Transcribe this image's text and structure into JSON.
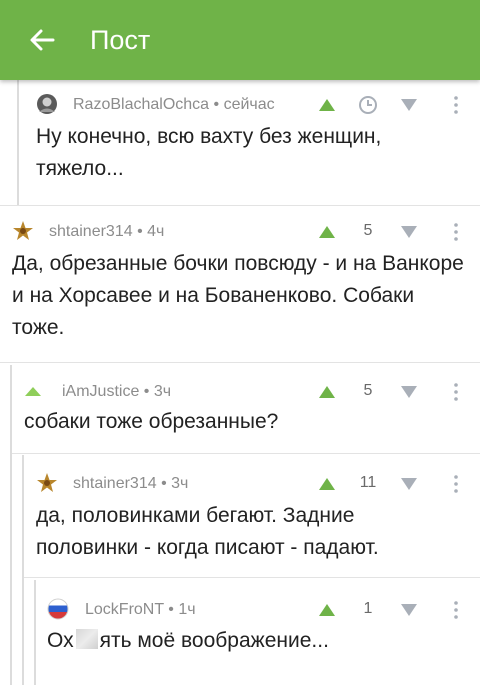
{
  "appbar": {
    "title": "Пост",
    "back_icon": "arrow-left-icon",
    "color": "#6fb348"
  },
  "comments": [
    {
      "author": "RazoBlachalOchca",
      "time": "сейчас",
      "rating": "",
      "text": "Ну конечно, всю вахту без женщин, тяжело...",
      "avatar_icon": "photo-avatar-icon",
      "rating_icon": "clock-icon"
    },
    {
      "author": "shtainer314",
      "time": "4ч",
      "rating": "5",
      "text": "Да, обрезанные бочки повсюду - и на Ванкоре и на Хорсавее и на Бованенково. Собаки тоже.",
      "avatar_icon": "star-emblem-avatar-icon"
    },
    {
      "author": "iAmJustice",
      "time": "3ч",
      "rating": "5",
      "text": "собаки тоже обрезанные?",
      "avatar_icon": "triangle-avatar-icon"
    },
    {
      "author": "shtainer314",
      "time": "3ч",
      "rating": "11",
      "text": "да, половинками бегают. Задние половинки - когда писают - падают.",
      "avatar_icon": "star-emblem-avatar-icon"
    },
    {
      "author": "LockFroNT",
      "time": "1ч",
      "rating": "1",
      "text_before": "Ох",
      "text_after": "ять моё воображение...",
      "avatar_icon": "flag-avatar-icon"
    }
  ],
  "icons": {
    "upvote": "upvote-triangle-icon",
    "downvote": "downvote-triangle-icon",
    "more": "more-vertical-icon"
  },
  "colors": {
    "accent": "#6fb348",
    "meta": "#8c8c8c",
    "vote_down": "#a9afb8"
  }
}
